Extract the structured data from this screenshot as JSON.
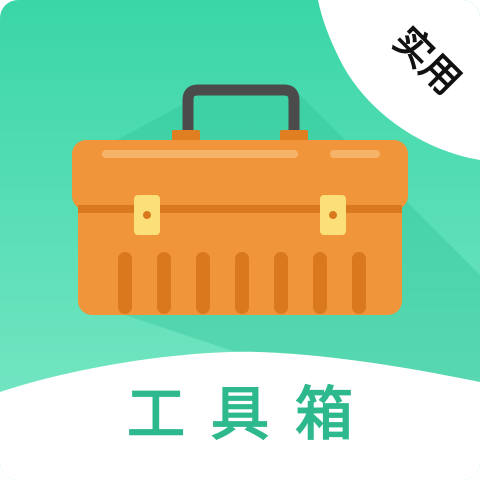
{
  "app_icon": {
    "title": "工具箱",
    "badge": "实用",
    "icon": "toolbox-icon"
  },
  "colors": {
    "background_top": "#3ad6a8",
    "background_bottom": "#7ee8c6",
    "badge_background": "#ffffff",
    "title_text": "#2db88e",
    "toolbox_body": "#f0953a",
    "toolbox_shadow": "#d9781c",
    "latch": "#fbe07a",
    "handle": "#4b4b4b"
  }
}
